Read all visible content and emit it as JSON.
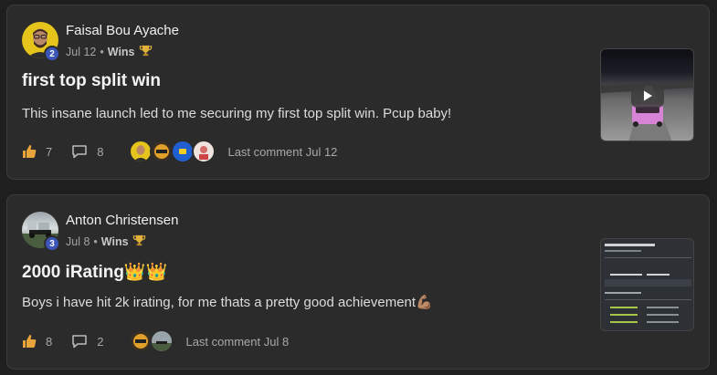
{
  "posts": [
    {
      "author": "Faisal Bou Ayache",
      "level": "2",
      "date": "Jul 12",
      "separator": "•",
      "category": "Wins",
      "category_icon": "trophy-icon",
      "title": "first top split win",
      "body": "This insane launch led to me securing my first top split win. Pcup baby!",
      "likes": "7",
      "comments": "8",
      "last_comment": "Last comment Jul 12",
      "commenter_avatars": [
        "avatar-yellow",
        "avatar-helmet",
        "avatar-blue",
        "avatar-pink"
      ],
      "thumbnail": "video"
    },
    {
      "author": "Anton Christensen",
      "level": "3",
      "date": "Jul 8",
      "separator": "•",
      "category": "Wins",
      "category_icon": "trophy-icon",
      "title": "2000 iRating👑👑",
      "body": "Boys i have hit 2k irating, for me thats a pretty good achievement💪🏽",
      "likes": "8",
      "comments": "2",
      "last_comment": "Last comment Jul 8",
      "commenter_avatars": [
        "avatar-helmet",
        "avatar-photo"
      ],
      "thumbnail": "screenshot"
    }
  ],
  "colors": {
    "background": "#1f1f1f",
    "card": "#2b2b2b",
    "badge": "#3c55b8",
    "trophy": "#e2b13c"
  }
}
